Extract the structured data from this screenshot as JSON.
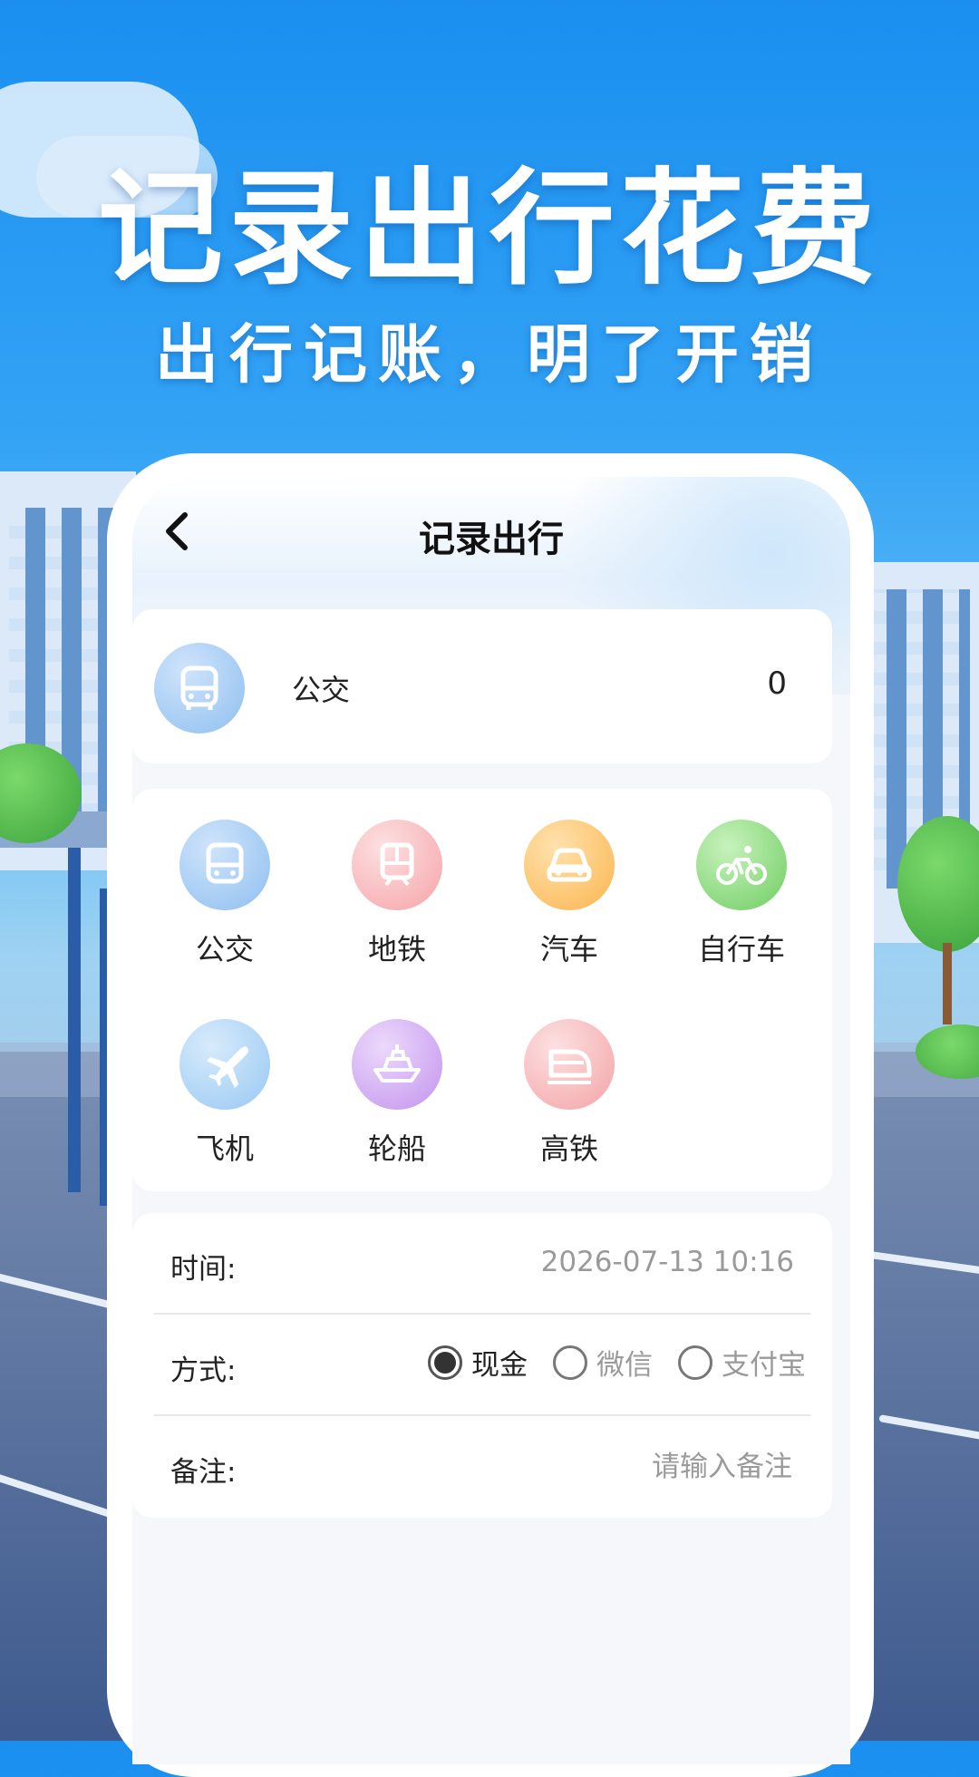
{
  "promo": {
    "headline": "记录出行花费",
    "subline": "出行记账，明了开销"
  },
  "nav": {
    "title": "记录出行",
    "back_icon": "chevron-left-icon"
  },
  "selected": {
    "label": "公交",
    "amount": "0",
    "icon": "bus-icon"
  },
  "transport_options": [
    {
      "label": "公交",
      "icon": "bus-icon",
      "color": "#9ccaf4"
    },
    {
      "label": "地铁",
      "icon": "subway-icon",
      "color": "#f8b9bc"
    },
    {
      "label": "汽车",
      "icon": "car-icon",
      "color": "#fcc877"
    },
    {
      "label": "自行车",
      "icon": "bicycle-icon",
      "color": "#92dc8a"
    },
    {
      "label": "飞机",
      "icon": "airplane-icon",
      "color": "#a9d2f6"
    },
    {
      "label": "轮船",
      "icon": "ship-icon",
      "color": "#d5b4f2"
    },
    {
      "label": "高铁",
      "icon": "high-speed-train-icon",
      "color": "#f7bdbf"
    }
  ],
  "form": {
    "time_label": "时间:",
    "time_value": "2026-07-13 10:16",
    "method_label": "方式:",
    "methods": [
      {
        "label": "现金",
        "selected": true
      },
      {
        "label": "微信",
        "selected": false
      },
      {
        "label": "支付宝",
        "selected": false
      }
    ],
    "note_label": "备注:",
    "note_placeholder": "请输入备注",
    "note_value": ""
  }
}
